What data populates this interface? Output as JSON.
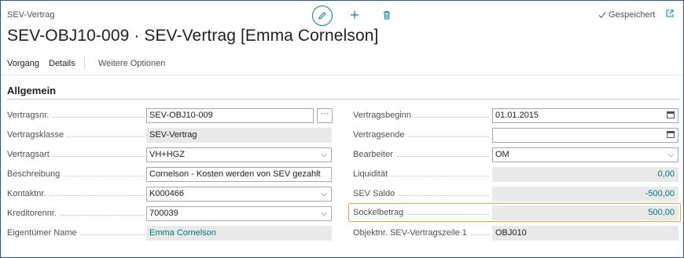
{
  "header": {
    "caption": "SEV-Vertrag",
    "title": "SEV-OBJ10-009 · SEV-Vertrag [Emma Cornelson]",
    "saved_label": "Gespeichert",
    "icons": {
      "edit": "pencil-icon",
      "new": "plus-icon",
      "delete": "trash-icon",
      "saved": "check-icon",
      "popout": "popout-icon"
    }
  },
  "actions": {
    "process": "Vorgang",
    "details": "Details",
    "more": "Weitere Optionen"
  },
  "section": {
    "title": "Allgemein"
  },
  "left_fields": [
    {
      "label": "Vertragsnr.",
      "value": "SEV-OBJ10-009",
      "kind": "input",
      "assist": "···"
    },
    {
      "label": "Vertragsklasse",
      "value": "SEV-Vertrag",
      "kind": "readonly"
    },
    {
      "label": "Vertragsart",
      "value": "VH+HGZ",
      "kind": "select"
    },
    {
      "label": "Beschreibung",
      "value": "Cornelson - Kosten werden von SEV gezahlt",
      "kind": "input"
    },
    {
      "label": "Kontaktnr.",
      "value": "K000466",
      "kind": "select"
    },
    {
      "label": "Kreditorennr.",
      "value": "700039",
      "kind": "select"
    },
    {
      "label": "Eigentümer Name",
      "value": "Emma Cornelson",
      "kind": "readonly-link"
    }
  ],
  "right_fields": [
    {
      "label": "Vertragsbeginn",
      "value": "01.01.2015",
      "kind": "date"
    },
    {
      "label": "Vertragsende",
      "value": "",
      "kind": "date"
    },
    {
      "label": "Bearbeiter",
      "value": "OM",
      "kind": "select"
    },
    {
      "label": "Liquidität",
      "value": "0,00",
      "kind": "readonly-number"
    },
    {
      "label": "SEV Saldo",
      "value": "-500,00",
      "kind": "readonly-number"
    },
    {
      "label": "Sockelbetrag",
      "value": "500,00",
      "kind": "readonly-number"
    },
    {
      "label": "Objektnr. SEV-Vertragszeile 1",
      "value": "OBJ010",
      "kind": "readonly"
    }
  ]
}
